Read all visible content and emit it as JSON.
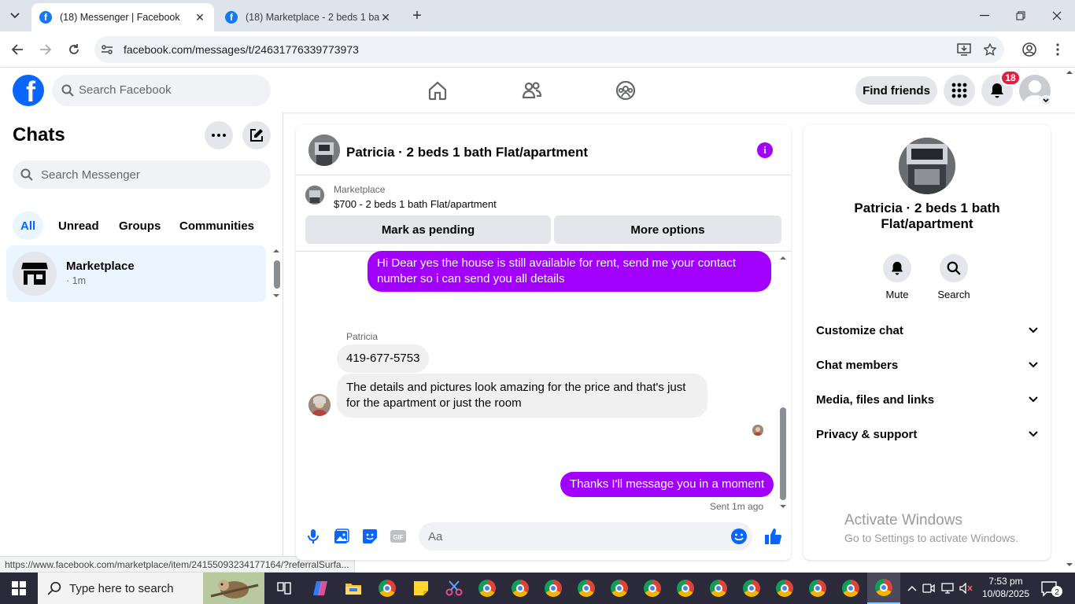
{
  "browser": {
    "tabs": [
      {
        "title": "(18) Messenger | Facebook",
        "active": true
      },
      {
        "title": "(18) Marketplace - 2 beds 1 bat",
        "active": false
      }
    ],
    "url": "facebook.com/messages/t/24631776339773973",
    "status_url": "https://www.facebook.com/marketplace/item/24155093234177164/?referralSurfa..."
  },
  "fb_nav": {
    "search_placeholder": "Search Facebook",
    "find_friends": "Find friends",
    "notification_count": "18"
  },
  "chats": {
    "title": "Chats",
    "search_placeholder": "Search Messenger",
    "filters": [
      "All",
      "Unread",
      "Groups",
      "Communities"
    ],
    "items": [
      {
        "name": "Marketplace",
        "meta": "· 1m"
      }
    ]
  },
  "conversation": {
    "title": "Patricia · 2 beds 1 bath Flat/apartment",
    "marketplace_label": "Marketplace",
    "listing": "$700 - 2 beds 1 bath Flat/apartment",
    "mark_pending": "Mark as pending",
    "more_options": "More options",
    "messages": [
      {
        "from": "me",
        "text": "Hi Dear yes the house is still available for rent, send me your contact number so i can send you all details"
      },
      {
        "from": "Patricia",
        "text": "419-677-5753"
      },
      {
        "from": "Patricia",
        "text": "The details and pictures look amazing for the price and that's just for the apartment or just the room"
      },
      {
        "from": "me",
        "text": "Thanks I'll message you in a moment"
      }
    ],
    "sender_name": "Patricia",
    "sent_meta": "Sent 1m ago",
    "composer_placeholder": "Aa",
    "gif_label": "GIF"
  },
  "info_panel": {
    "name": "Patricia · 2 beds 1 bath Flat/apartment",
    "actions": [
      "Mute",
      "Search"
    ],
    "sections": [
      "Customize chat",
      "Chat members",
      "Media, files and links",
      "Privacy & support"
    ]
  },
  "watermark": {
    "line1": "Activate Windows",
    "line2": "Go to Settings to activate Windows."
  },
  "taskbar": {
    "search_placeholder": "Type here to search",
    "time": "7:53 pm",
    "date": "10/08/2025",
    "notif_count": "2"
  },
  "colors": {
    "fb_blue": "#0866ff",
    "bubble_purple": "#a100ff",
    "badge_red": "#e41e3f"
  }
}
